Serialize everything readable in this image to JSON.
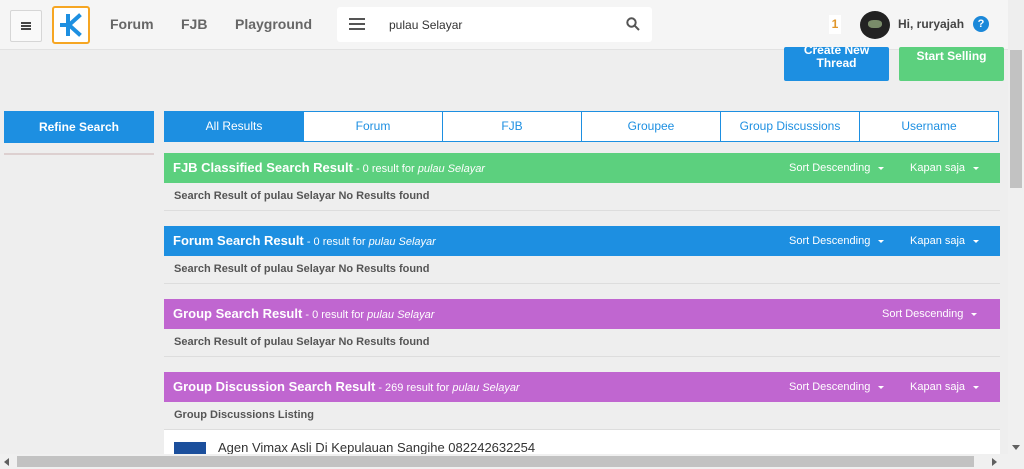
{
  "header": {
    "nav": [
      "Forum",
      "FJB",
      "Playground"
    ],
    "search": {
      "value": "pulau Selayar"
    },
    "notification_count": "1",
    "greeting": "Hi, ruryajah",
    "help_label": "?"
  },
  "actions": {
    "create_thread": "Create New Thread",
    "start_selling": "Start Selling"
  },
  "sidebar": {
    "refine_label": "Refine Search"
  },
  "tabs": [
    "All Results",
    "Forum",
    "FJB",
    "Groupee",
    "Group Discussions",
    "Username"
  ],
  "sections": [
    {
      "title": "FJB Classified Search Result",
      "count": " - 0 result for ",
      "query": "pulau Selayar",
      "sort": "Sort Descending",
      "time": "Kapan saja",
      "body": "Search Result of pulau Selayar No Results found",
      "color": "#5cd07e"
    },
    {
      "title": "Forum Search Result",
      "count": " - 0 result for ",
      "query": "pulau Selayar",
      "sort": "Sort Descending",
      "time": "Kapan saja",
      "body": "Search Result of pulau Selayar No Results found",
      "color": "#1d8fe1"
    },
    {
      "title": "Group Search Result",
      "count": " - 0 result for ",
      "query": "pulau Selayar",
      "sort": "Sort Descending",
      "body": "Search Result of pulau Selayar No Results found",
      "color": "#c066d0"
    },
    {
      "title": "Group Discussion Search Result",
      "count": " - 269 result for ",
      "query": "pulau Selayar",
      "sort": "Sort Descending",
      "time": "Kapan saja",
      "body": "Group Discussions Listing",
      "color": "#c066d0"
    }
  ],
  "listing": {
    "first_item": "Agen Vimax Asli Di Kepulauan Sangihe 082242632254"
  },
  "icons": {
    "menu": "hamburger-icon",
    "logo": "kaskus-logo-icon",
    "search": "search-icon",
    "help": "help-icon",
    "caret": "caret-down-icon"
  }
}
